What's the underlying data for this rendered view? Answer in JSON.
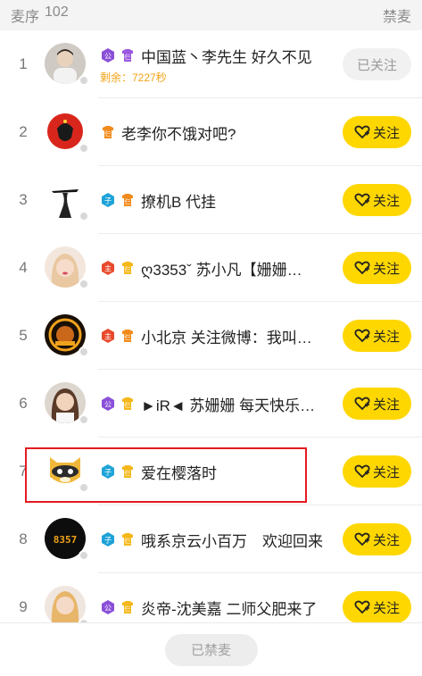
{
  "header": {
    "title": "麦序",
    "count": "102",
    "right_action": "禁麦"
  },
  "colors": {
    "follow_bg": "#ffd700",
    "highlight_border": "#e31b23",
    "countdown_text": "#f2a215"
  },
  "rows": [
    {
      "rank": "1",
      "badges": [
        "公",
        "仨"
      ],
      "name": "中国蓝丶李先生 好久不见",
      "sub": "剩余：7227秒",
      "button": "已关注",
      "followed": true,
      "avatar_icon": "person-photo-avatar-icon"
    },
    {
      "rank": "2",
      "badges": [
        "仨"
      ],
      "name": "老李你不饿对吧?",
      "sub": "",
      "button": "关注",
      "followed": false,
      "avatar_icon": "red-portrait-avatar-icon"
    },
    {
      "rank": "3",
      "badges": [
        "子",
        "仨"
      ],
      "name": "撩机B 代挂",
      "sub": "",
      "button": "关注",
      "followed": false,
      "avatar_icon": "silhouette-avatar-icon"
    },
    {
      "rank": "4",
      "badges": [
        "主",
        "仨"
      ],
      "name": "ღ3353ˇ 苏小凡【姗姗…",
      "sub": "",
      "button": "关注",
      "followed": false,
      "avatar_icon": "girl-photo-avatar-icon"
    },
    {
      "rank": "5",
      "badges": [
        "主",
        "仨"
      ],
      "name": "小北京 关注微博：我叫…",
      "sub": "",
      "button": "关注",
      "followed": false,
      "avatar_icon": "gold-logo-avatar-icon"
    },
    {
      "rank": "6",
      "badges": [
        "公",
        "仨"
      ],
      "name": "►iR◄ 苏姗姗 每天快乐…",
      "sub": "",
      "button": "关注",
      "followed": false,
      "avatar_icon": "woman-photo-avatar-icon"
    },
    {
      "rank": "7",
      "badges": [
        "子",
        "仨"
      ],
      "name": "爱在樱落时",
      "sub": "",
      "button": "关注",
      "followed": false,
      "avatar_icon": "raccoon-mascot-avatar-icon"
    },
    {
      "rank": "8",
      "badges": [
        "子",
        "仨"
      ],
      "name": "哦系京云小百万　欢迎回来",
      "sub": "",
      "button": "关注",
      "followed": false,
      "avatar_icon": "number-8357-avatar-icon"
    },
    {
      "rank": "9",
      "badges": [
        "公",
        "仨"
      ],
      "name": "炎帝-沈美嘉 二师父肥来了",
      "sub": "",
      "button": "关注",
      "followed": false,
      "avatar_icon": "blonde-photo-avatar-icon"
    }
  ],
  "avatar_text": {
    "row8": "8357"
  },
  "footer": {
    "button": "已禁麦"
  }
}
